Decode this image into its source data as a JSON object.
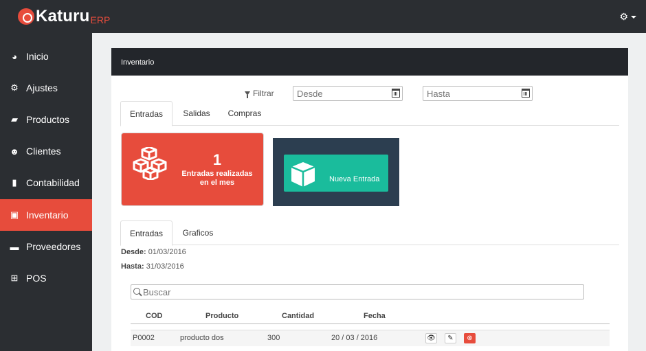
{
  "brand": {
    "name": "Katuru",
    "suffix": "ERP",
    "accent": "#e74c3c"
  },
  "topbar": {
    "settings_icon": "gear-icon",
    "settings_glyph": "⚙"
  },
  "sidebar": {
    "items": [
      {
        "label": "Inicio",
        "icon": "dashboard-icon",
        "glyph": "◕"
      },
      {
        "label": "Ajustes",
        "icon": "cogs-icon",
        "glyph": "⚙"
      },
      {
        "label": "Productos",
        "icon": "basket-icon",
        "glyph": "▰"
      },
      {
        "label": "Clientes",
        "icon": "users-icon",
        "glyph": "☻"
      },
      {
        "label": "Contabilidad",
        "icon": "book-icon",
        "glyph": "▮"
      },
      {
        "label": "Inventario",
        "icon": "cubes-icon",
        "glyph": "▣",
        "active": true
      },
      {
        "label": "Proveedores",
        "icon": "truck-icon",
        "glyph": "▬"
      },
      {
        "label": "POS",
        "icon": "cart-icon",
        "glyph": "⊞"
      }
    ]
  },
  "panel": {
    "title": "Inventario"
  },
  "filter": {
    "label": "Filtrar",
    "from_placeholder": "Desde",
    "to_placeholder": "Hasta"
  },
  "tabs_top": [
    "Entradas",
    "Salidas",
    "Compras"
  ],
  "stat": {
    "number": "1",
    "label": "Entradas realizadas en el mes",
    "color": "#e74c3c"
  },
  "new_entry": {
    "label": "Nueva Entrada",
    "bg": "#2c3e50",
    "button_color": "#1abc9c"
  },
  "tabs_bottom": [
    "Entradas",
    "Graficos"
  ],
  "range": {
    "from_label": "Desde:",
    "from_value": "01/03/2016",
    "to_label": "Hasta:",
    "to_value": "31/03/2016"
  },
  "search": {
    "placeholder": "Buscar"
  },
  "table": {
    "columns": [
      "COD",
      "Producto",
      "Cantidad",
      "Fecha"
    ],
    "rows": [
      {
        "cod": "P0002",
        "producto": "producto dos",
        "cantidad": "300",
        "fecha": "20 / 03 / 2016"
      }
    ],
    "actions": [
      {
        "name": "view-icon",
        "glyph": "👁"
      },
      {
        "name": "edit-icon",
        "glyph": "✎"
      },
      {
        "name": "delete-icon",
        "glyph": "⊗"
      }
    ]
  }
}
